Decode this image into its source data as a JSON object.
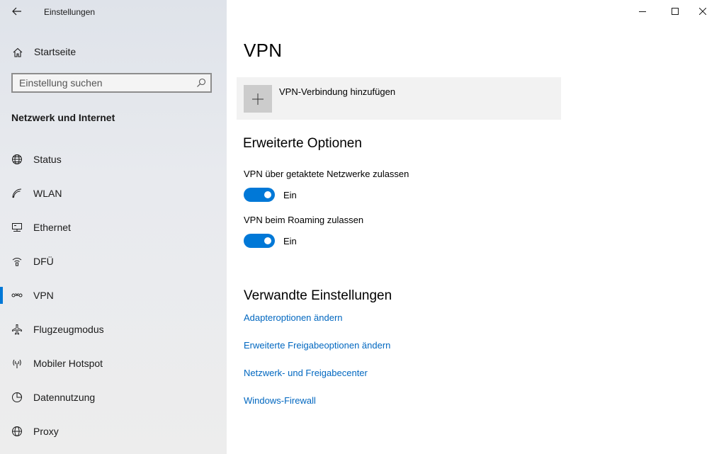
{
  "window": {
    "app_title": "Einstellungen"
  },
  "sidebar": {
    "home_label": "Startseite",
    "search_placeholder": "Einstellung suchen",
    "section_title": "Netzwerk und Internet",
    "items": [
      {
        "label": "Status",
        "icon": "globe-network-icon"
      },
      {
        "label": "WLAN",
        "icon": "wifi-icon"
      },
      {
        "label": "Ethernet",
        "icon": "ethernet-icon"
      },
      {
        "label": "DFÜ",
        "icon": "dialup-icon"
      },
      {
        "label": "VPN",
        "icon": "vpn-icon",
        "selected": true
      },
      {
        "label": "Flugzeugmodus",
        "icon": "airplane-icon"
      },
      {
        "label": "Mobiler Hotspot",
        "icon": "hotspot-icon"
      },
      {
        "label": "Datennutzung",
        "icon": "data-usage-icon"
      },
      {
        "label": "Proxy",
        "icon": "globe-icon"
      }
    ]
  },
  "main": {
    "title": "VPN",
    "add_vpn_label": "VPN-Verbindung hinzufügen",
    "advanced": {
      "heading": "Erweiterte Optionen",
      "options": [
        {
          "label": "VPN über getaktete Netzwerke zulassen",
          "state": "Ein",
          "on": true
        },
        {
          "label": "VPN beim Roaming zulassen",
          "state": "Ein",
          "on": true
        }
      ]
    },
    "related": {
      "heading": "Verwandte Einstellungen",
      "links": [
        "Adapteroptionen ändern",
        "Erweiterte Freigabeoptionen ändern",
        "Netzwerk- und Freigabecenter",
        "Windows-Firewall"
      ]
    }
  },
  "colors": {
    "accent": "#0078d7",
    "link": "#0067c0",
    "sidebar_bg": "#e8eaee",
    "add_button_bg": "#f2f2f2"
  }
}
